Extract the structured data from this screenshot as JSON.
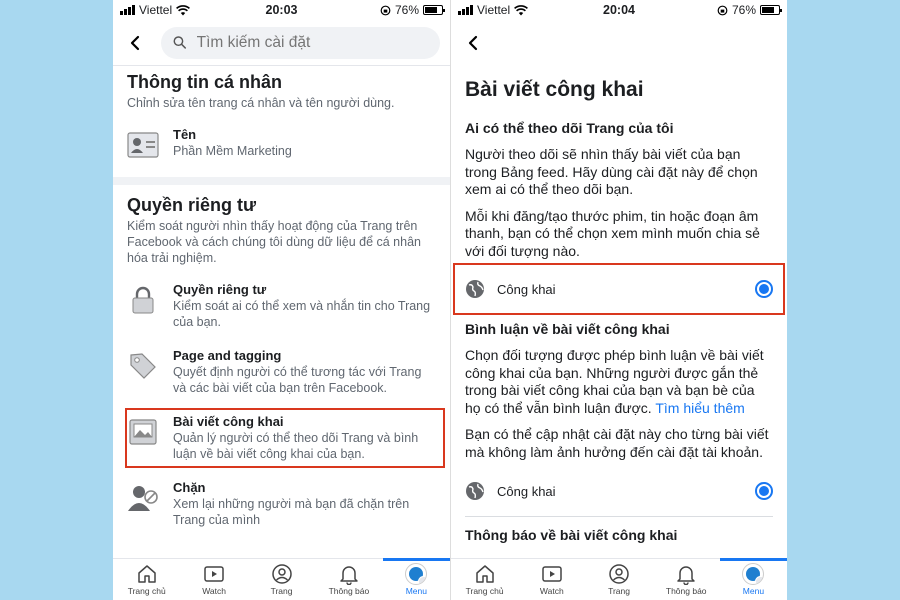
{
  "status_left": {
    "carrier": "Viettel",
    "time": "20:03",
    "battery": "76%"
  },
  "status_right": {
    "carrier": "Viettel",
    "time": "20:04",
    "battery": "76%"
  },
  "search": {
    "placeholder": "Tìm kiếm cài đặt"
  },
  "personal": {
    "title": "Thông tin cá nhân",
    "desc": "Chỉnh sửa tên trang cá nhân và tên người dùng.",
    "name_title": "Tên",
    "name_value": "Phần Mềm Marketing"
  },
  "privacy": {
    "title": "Quyền riêng tư",
    "desc": "Kiểm soát người nhìn thấy hoạt động của Trang trên Facebook và cách chúng tôi dùng dữ liệu để cá nhân hóa trải nghiệm.",
    "items": [
      {
        "title": "Quyền riêng tư",
        "sub": "Kiểm soát ai có thể xem và nhắn tin cho Trang của bạn."
      },
      {
        "title": "Page and tagging",
        "sub": "Quyết định người có thể tương tác với Trang và các bài viết của bạn trên Facebook."
      },
      {
        "title": "Bài viết công khai",
        "sub": "Quản lý người có thể theo dõi Trang và bình luận về bài viết công khai của bạn."
      },
      {
        "title": "Chặn",
        "sub": "Xem lại những người mà bạn đã chặn trên Trang của mình"
      }
    ]
  },
  "tabs": [
    "Trang chủ",
    "Watch",
    "Trang",
    "Thông báo",
    "Menu"
  ],
  "public_posts": {
    "title": "Bài viết công khai",
    "follow_heading": "Ai có thể theo dõi Trang của tôi",
    "follow_p1": "Người theo dõi sẽ nhìn thấy bài viết của bạn trong Bảng feed. Hãy dùng cài đặt này để chọn xem ai có thể theo dõi bạn.",
    "follow_p2": "Mỗi khi đăng/tạo thước phim, tin hoặc đoạn âm thanh, bạn có thể chọn xem mình muốn chia sẻ với đối tượng nào.",
    "follow_option": "Công khai",
    "comment_heading": "Bình luận về bài viết công khai",
    "comment_p1": "Chọn đối tượng được phép bình luận về bài viết công khai của bạn. Những người được gắn thẻ trong bài viết công khai của bạn và bạn bè của họ có thể vẫn bình luận được.",
    "comment_link": "Tìm hiểu thêm",
    "comment_p2": "Bạn có thể cập nhật cài đặt này cho từng bài viết mà không làm ảnh hưởng đến cài đặt tài khoản.",
    "comment_option": "Công khai",
    "notify_heading": "Thông báo về bài viết công khai"
  },
  "colors": {
    "accent": "#1877f2",
    "highlight": "#d9381e",
    "background": "#a8d8f0"
  }
}
